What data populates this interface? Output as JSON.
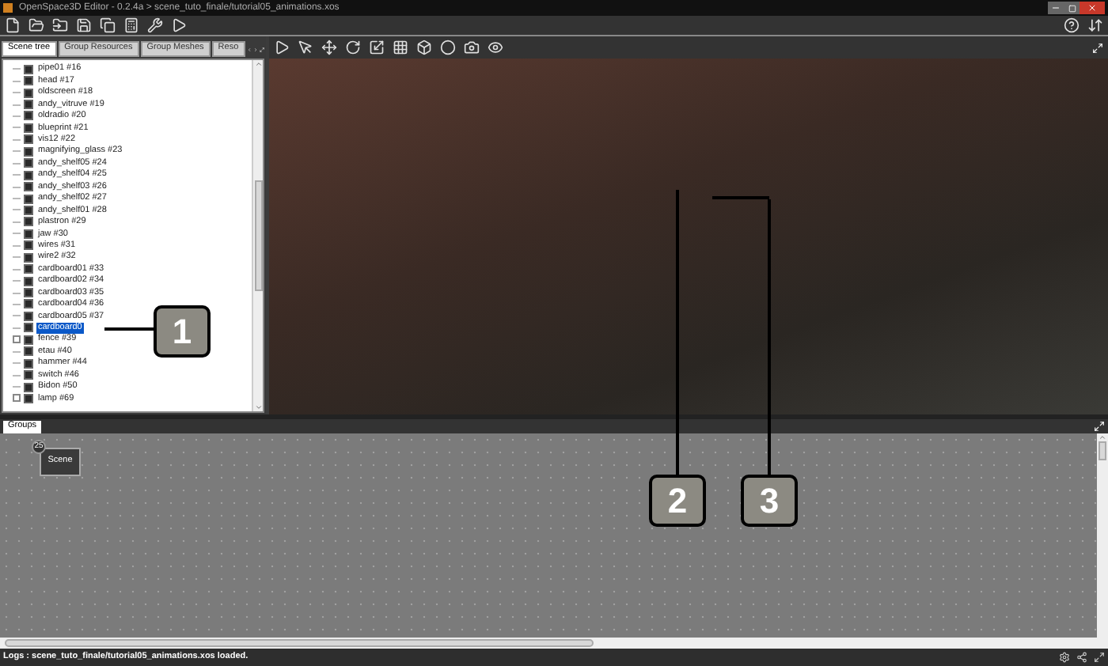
{
  "window": {
    "title": "OpenSpace3D Editor - 0.2.4a > scene_tuto_finale/tutorial05_animations.xos"
  },
  "left_panel": {
    "tabs": [
      {
        "label": "Scene tree",
        "selected": true
      },
      {
        "label": "Group Resources",
        "selected": false
      },
      {
        "label": "Group Meshes",
        "selected": false
      },
      {
        "label": "Reso",
        "selected": false
      }
    ],
    "tree": [
      {
        "label": "pipe01 #16",
        "selected": false,
        "has_children": false
      },
      {
        "label": "head #17",
        "selected": false,
        "has_children": false
      },
      {
        "label": "oldscreen #18",
        "selected": false,
        "has_children": false
      },
      {
        "label": "andy_vitruve #19",
        "selected": false,
        "has_children": false
      },
      {
        "label": "oldradio #20",
        "selected": false,
        "has_children": false
      },
      {
        "label": "blueprint #21",
        "selected": false,
        "has_children": false
      },
      {
        "label": "vis12 #22",
        "selected": false,
        "has_children": false
      },
      {
        "label": "magnifying_glass #23",
        "selected": false,
        "has_children": false
      },
      {
        "label": "andy_shelf05 #24",
        "selected": false,
        "has_children": false
      },
      {
        "label": "andy_shelf04 #25",
        "selected": false,
        "has_children": false
      },
      {
        "label": "andy_shelf03 #26",
        "selected": false,
        "has_children": false
      },
      {
        "label": "andy_shelf02 #27",
        "selected": false,
        "has_children": false
      },
      {
        "label": "andy_shelf01 #28",
        "selected": false,
        "has_children": false
      },
      {
        "label": "plastron #29",
        "selected": false,
        "has_children": false
      },
      {
        "label": "jaw #30",
        "selected": false,
        "has_children": false
      },
      {
        "label": "wires #31",
        "selected": false,
        "has_children": false
      },
      {
        "label": "wire2 #32",
        "selected": false,
        "has_children": false
      },
      {
        "label": "cardboard01 #33",
        "selected": false,
        "has_children": false
      },
      {
        "label": "cardboard02 #34",
        "selected": false,
        "has_children": false
      },
      {
        "label": "cardboard03 #35",
        "selected": false,
        "has_children": false
      },
      {
        "label": "cardboard04 #36",
        "selected": false,
        "has_children": false
      },
      {
        "label": "cardboard05 #37",
        "selected": false,
        "has_children": false
      },
      {
        "label": "cardboard0",
        "selected": true,
        "has_children": false
      },
      {
        "label": "fence #39",
        "selected": false,
        "has_children": true
      },
      {
        "label": "etau #40",
        "selected": false,
        "has_children": false
      },
      {
        "label": "hammer #44",
        "selected": false,
        "has_children": false
      },
      {
        "label": "switch #46",
        "selected": false,
        "has_children": false
      },
      {
        "label": "Bidon #50",
        "selected": false,
        "has_children": false
      },
      {
        "label": "lamp #69",
        "selected": false,
        "has_children": true
      }
    ]
  },
  "groups_panel": {
    "tab": "Groups",
    "node": {
      "label": "Scene",
      "badge": "25"
    }
  },
  "status_bar": "Logs : scene_tuto_finale/tutorial05_animations.xos loaded.",
  "callouts": [
    "1",
    "2",
    "3"
  ]
}
